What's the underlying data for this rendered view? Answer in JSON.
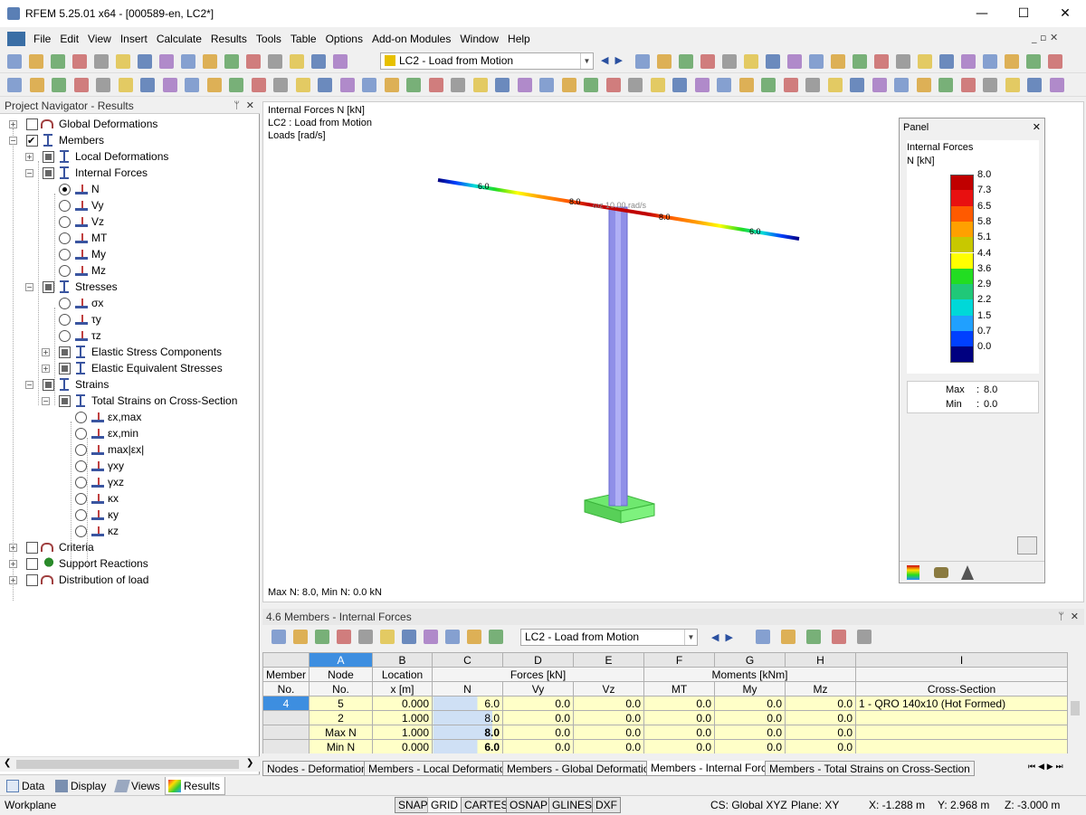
{
  "app": {
    "title": "RFEM 5.25.01 x64 - [000589-en, LC2*]"
  },
  "menu": [
    "File",
    "Edit",
    "View",
    "Insert",
    "Calculate",
    "Results",
    "Tools",
    "Table",
    "Options",
    "Add-on Modules",
    "Window",
    "Help"
  ],
  "toolbar": {
    "loadcase": "LC2 - Load from Motion"
  },
  "navigator": {
    "title": "Project Navigator - Results",
    "items": {
      "global_def": "Global Deformations",
      "members": "Members",
      "local_def": "Local Deformations",
      "internal_forces": "Internal Forces",
      "n": "N",
      "vy": "Vy",
      "vz": "Vz",
      "mt": "MT",
      "my": "My",
      "mz": "Mz",
      "stresses": "Stresses",
      "sx": "σx",
      "ty": "τy",
      "tz": "τz",
      "elastic_comp": "Elastic Stress Components",
      "elastic_eq": "Elastic Equivalent Stresses",
      "strains": "Strains",
      "total_strains": "Total Strains on Cross-Section",
      "exmax": "εx,max",
      "exmin": "εx,min",
      "maxex": "max|εx|",
      "gxy": "γxy",
      "gxz": "γxz",
      "kx": "κx",
      "ky": "κy",
      "kz": "κz",
      "criteria": "Criteria",
      "support": "Support Reactions",
      "distribution": "Distribution of load"
    },
    "tabs": [
      "Data",
      "Display",
      "Views",
      "Results"
    ]
  },
  "view": {
    "info1": "Internal Forces N [kN]",
    "info2": "LC2 : Load from Motion",
    "info3": "Loads [rad/s]",
    "footer": "Max N: 8.0, Min N: 0.0 kN",
    "labels": {
      "l1": "6.0",
      "l2": "8.0",
      "l3": "8.0",
      "l4": "6.0",
      "load": "ωz 10.00 rad/s"
    }
  },
  "panel": {
    "title": "Panel",
    "subtitle": "Internal Forces",
    "unit": "N [kN]",
    "legend": [
      "8.0",
      "7.3",
      "6.5",
      "5.8",
      "5.1",
      "4.4",
      "3.6",
      "2.9",
      "2.2",
      "1.5",
      "0.7",
      "0.0"
    ],
    "colors": [
      "#c00000",
      "#e81010",
      "#ff5a00",
      "#ffa000",
      "#c8c800",
      "#ffff00",
      "#22dd22",
      "#20c878",
      "#00d8d8",
      "#20a0ff",
      "#0040ff",
      "#000080"
    ],
    "max_label": "Max",
    "max_val": "8.0",
    "min_label": "Min",
    "min_val": "0.0"
  },
  "table": {
    "title": "4.6 Members - Internal Forces",
    "loadcase": "LC2 - Load from Motion",
    "col_letters": [
      "A",
      "B",
      "C",
      "D",
      "E",
      "F",
      "G",
      "H",
      "I"
    ],
    "h1": {
      "member": "Member",
      "forces": "Forces [kN]",
      "moments": "Moments [kNm]",
      "node": "Node",
      "location": "Location"
    },
    "h2": {
      "member": "No.",
      "node": "No.",
      "x": "x [m]",
      "n": "N",
      "vy": "Vy",
      "vz": "Vz",
      "mt": "MT",
      "my": "My",
      "mz": "Mz",
      "cs": "Cross-Section"
    },
    "rows": [
      {
        "member": "4",
        "node": "5",
        "x": "0.000",
        "n": "6.0",
        "vy": "0.0",
        "vz": "0.0",
        "mt": "0.0",
        "my": "0.0",
        "mz": "0.0",
        "cs": "1 - QRO 140x10 (Hot Formed)"
      },
      {
        "member": "",
        "node": "2",
        "x": "1.000",
        "n": "8.0",
        "vy": "0.0",
        "vz": "0.0",
        "mt": "0.0",
        "my": "0.0",
        "mz": "0.0",
        "cs": ""
      },
      {
        "member": "",
        "node": "Max N",
        "x": "1.000",
        "n": "8.0",
        "vy": "0.0",
        "vz": "0.0",
        "mt": "0.0",
        "my": "0.0",
        "mz": "0.0",
        "cs": ""
      },
      {
        "member": "",
        "node": "Min N",
        "x": "0.000",
        "n": "6.0",
        "vy": "0.0",
        "vz": "0.0",
        "mt": "0.0",
        "my": "0.0",
        "mz": "0.0",
        "cs": ""
      }
    ],
    "tabs": [
      "Nodes - Deformations",
      "Members - Local Deformations",
      "Members - Global Deformations",
      "Members - Internal Forces",
      "Members - Total Strains on Cross-Section"
    ]
  },
  "status": {
    "workplane": "Workplane",
    "buttons": [
      "SNAP",
      "GRID",
      "CARTES",
      "OSNAP",
      "GLINES",
      "DXF"
    ],
    "cs": "CS: Global XYZ",
    "plane": "Plane: XY",
    "x": "X:  -1.288 m",
    "y": "Y:  2.968 m",
    "z": "Z:  -3.000 m"
  }
}
